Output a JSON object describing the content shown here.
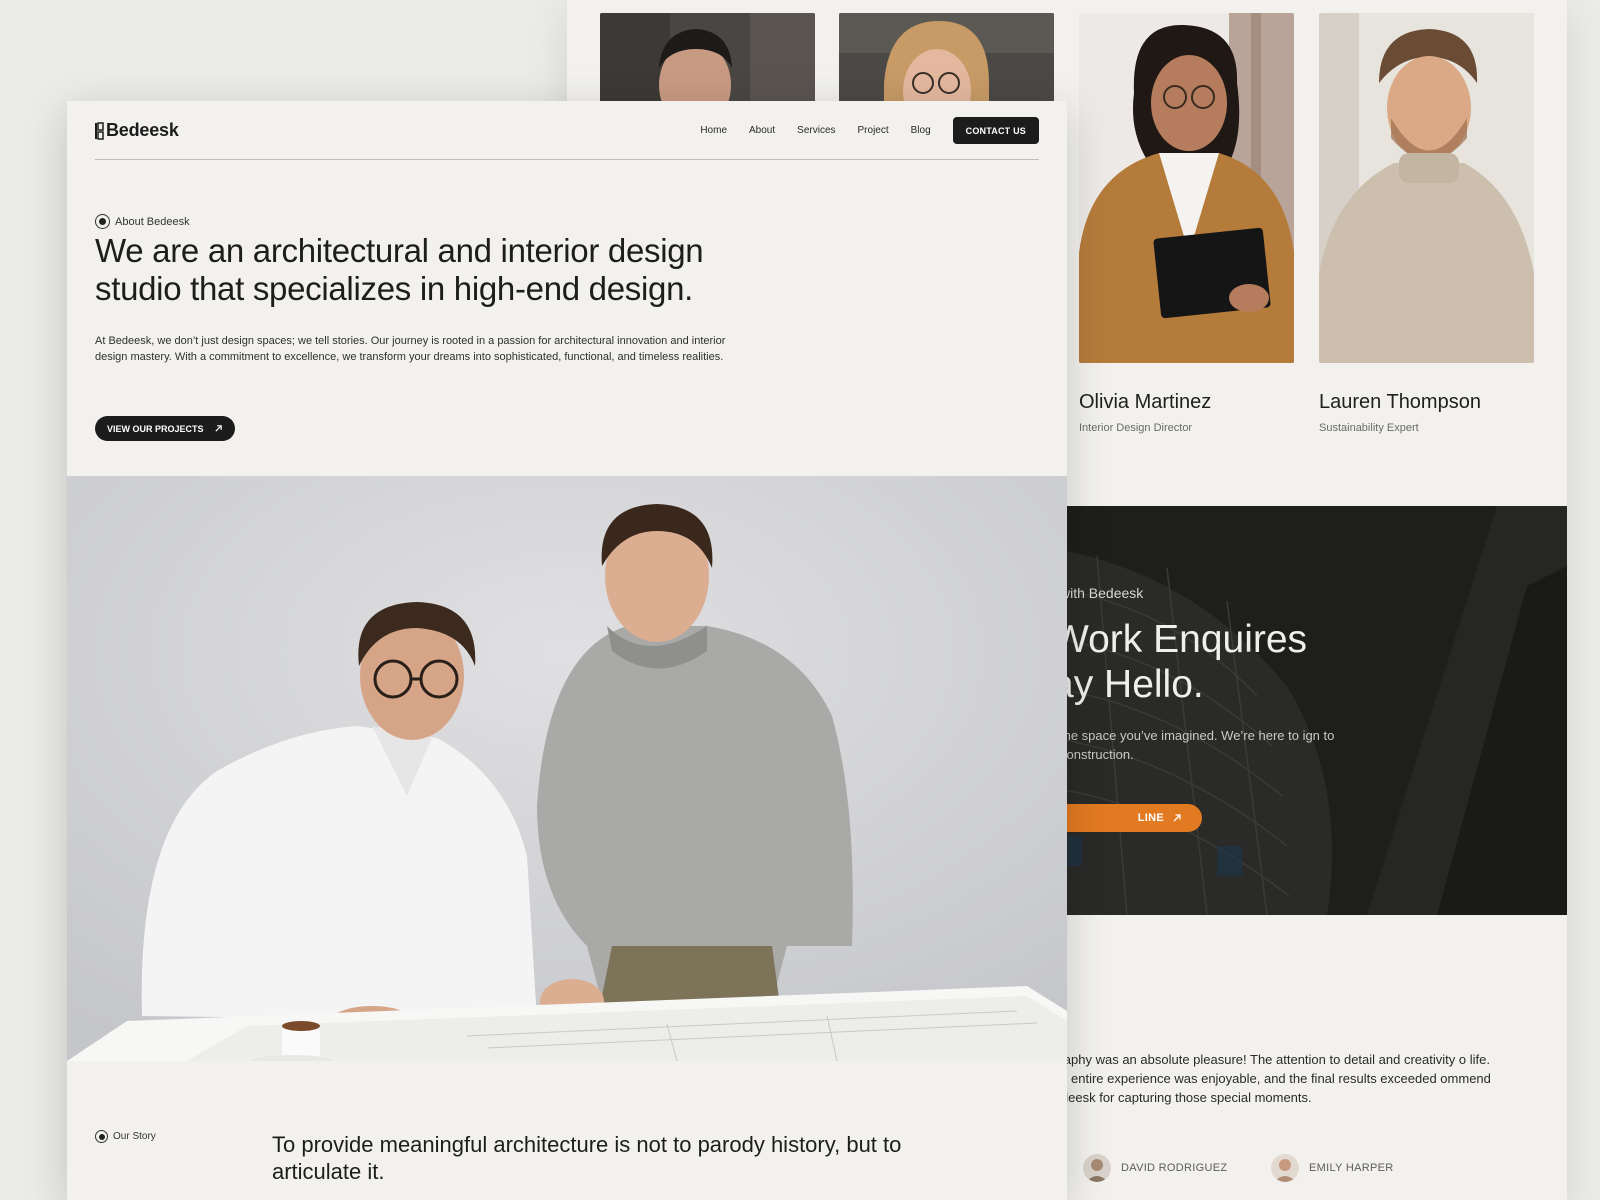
{
  "brand": {
    "name": "Bedeesk"
  },
  "nav": {
    "links": [
      "Home",
      "About",
      "Services",
      "Project",
      "Blog"
    ],
    "contact_label": "CONTACT US"
  },
  "about": {
    "eyebrow": "About Bedeesk",
    "headline": "We are an architectural and interior design studio that specializes in high-end design.",
    "intro": "At Bedeesk, we don’t just design spaces; we tell stories. Our journey is rooted in a passion for architectural innovation and interior design mastery. With a commitment to excellence, we transform your dreams into sophisticated, functional, and timeless realities.",
    "button_label": "VIEW OUR PROJECTS"
  },
  "story": {
    "eyebrow": "Our Story",
    "quote": "To provide meaningful architecture is not to parody history, but to articulate it."
  },
  "team": [
    {
      "name": "",
      "role": ""
    },
    {
      "name": "",
      "role": ""
    },
    {
      "name": "Olivia Martinez",
      "role": "Interior Design Director"
    },
    {
      "name": "Lauren Thompson",
      "role": "Sustainability Expert"
    }
  ],
  "cta": {
    "kicker": "with Bedeesk",
    "title_line1": "Work Enquires",
    "title_line2": "ay Hello.",
    "text": "the space you’ve imagined. We’re here to ign to construction.",
    "button_label": "LINE"
  },
  "testimonial": {
    "text": "ography was an absolute pleasure! The attention to detail and creativity o life. The entire experience was enjoyable, and the final results exceeded ommend Bedeesk for capturing those special moments.",
    "reviewers": [
      "DAVID RODRIGUEZ",
      "EMILY HARPER"
    ]
  },
  "colors": {
    "page_bg": "#f2f1ed",
    "dark": "#1c1c1c",
    "accent_orange": "#e27a22",
    "cta_bg": "#1e1e1d"
  },
  "icons": [
    "arrow-up-right-icon",
    "dot-circle-icon",
    "logo-mark-icon"
  ]
}
